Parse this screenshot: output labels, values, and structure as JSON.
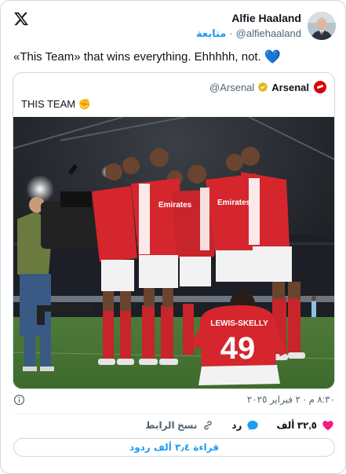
{
  "author": {
    "name": "Alfie Haaland",
    "handle": "@alfiehaaland",
    "follow_label": "متابعة",
    "separator": "·"
  },
  "tweet": {
    "text": "«This Team» that wins everything. Ehhhhh, not.",
    "emoji": "💙"
  },
  "quoted": {
    "name": "Arsenal",
    "handle": "@Arsenal",
    "text": "THIS TEAM",
    "emoji": "✊",
    "photo_number": "49",
    "photo_name": "LEWIS-SKELLY",
    "photo_sponsor": "Emirates"
  },
  "meta": {
    "timestamp": "٨:٣٠ م · ٢ فبراير ٢٠٢٥"
  },
  "actions": {
    "likes": "٣٢,٥ ألف",
    "reply_label": "رد",
    "copy_link_label": "نسخ الرابط"
  },
  "replies_button": "قراءة ٣٫٤ ألف ردود",
  "colors": {
    "accent": "#1d9bf0",
    "like": "#f91880",
    "arsenal_red": "#db0007"
  }
}
